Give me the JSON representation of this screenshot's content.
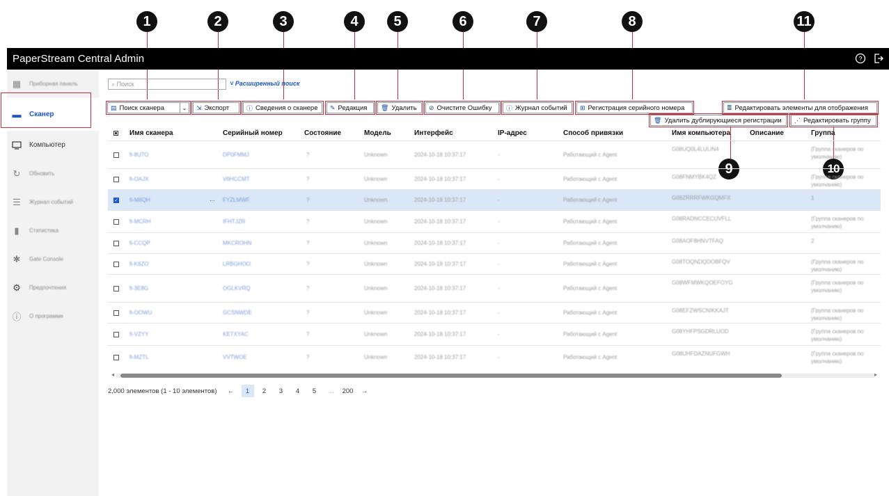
{
  "callouts": [
    "1",
    "2",
    "3",
    "4",
    "5",
    "6",
    "7",
    "8",
    "9",
    "10",
    "11"
  ],
  "app": {
    "title": "PaperStream Central Admin"
  },
  "header_icons": [
    "help-icon",
    "logout-icon"
  ],
  "sidebar": {
    "items": [
      {
        "label": "Приборная панель",
        "icon": "dashboard-icon"
      },
      {
        "label": "Сканер",
        "icon": "scanner-icon"
      },
      {
        "label": "Компьютер",
        "icon": "computer-icon"
      },
      {
        "label": "Обновить",
        "icon": "refresh-icon"
      },
      {
        "label": "Журнал событий",
        "icon": "event-log-icon"
      },
      {
        "label": "Статистика",
        "icon": "statistics-icon"
      },
      {
        "label": "Gate Console",
        "icon": "gate-console-icon"
      },
      {
        "label": "Предпочтения",
        "icon": "preferences-icon"
      },
      {
        "label": "О программе",
        "icon": "about-icon"
      }
    ]
  },
  "search": {
    "placeholder": "Поиск",
    "advanced": "Расширенный поиск"
  },
  "toolbar": {
    "scanner_search": "Поиск сканера",
    "export": "Экспорт",
    "scanner_info": "Сведения о сканере",
    "edit": "Редакция",
    "delete": "Удалить",
    "clear_error": "Очистите Ошибку",
    "event_log": "Журнал событий",
    "serial_registration": "Регистрация серийного номера",
    "edit_display_items": "Редактировать элементы для отображения",
    "delete_duplicates": "Удалить дублирующиеся регистрации",
    "edit_group": "Редактировать группу"
  },
  "table": {
    "headers": [
      "Имя сканера",
      "Серийный номер",
      "Состояние",
      "Модель",
      "Интерфейс",
      "IP-адрес",
      "Способ привязки",
      "Имя компьютера",
      "Описание",
      "Группа"
    ],
    "rows": [
      {
        "name": "fi-8U7O",
        "serial": "DP0FMMJ",
        "state": "?",
        "model": "Unknown",
        "iface": "2024-10-18 10:37:17",
        "ip": "-",
        "bind": "Работающий с Agent",
        "pc": "G08UQ0L4LULIN4",
        "desc": "",
        "group": "(Группа сканеров по умолчанию)"
      },
      {
        "name": "fi-OAJX",
        "serial": "V6HCCMT",
        "state": "?",
        "model": "Unknown",
        "iface": "2024-10-18 10:37:17",
        "ip": "-",
        "bind": "Работающий с Agent",
        "pc": "G08FNMYBK4QZ",
        "desc": "",
        "group": "(Группа сканеров по умолчанию)"
      },
      {
        "name": "fi-M8QH",
        "serial": "FYZLMWF",
        "state": "?",
        "model": "Unknown",
        "iface": "2024-10-18 10:37:17",
        "ip": "-",
        "bind": "Работающий с Agent",
        "pc": "G08ZRRRFWKGQMFX",
        "desc": "",
        "group": "1"
      },
      {
        "name": "fi-MCRH",
        "serial": "IFHTJZR",
        "state": "?",
        "model": "Unknown",
        "iface": "2024-10-18 10:37:17",
        "ip": "-",
        "bind": "Работающий с Agent",
        "pc": "G08RADNCCECUVFLL",
        "desc": "",
        "group": "(Группа сканеров по умолчанию)"
      },
      {
        "name": "fi-CCQP",
        "serial": "MKCROHN",
        "state": "?",
        "model": "Unknown",
        "iface": "2024-10-18 10:37:17",
        "ip": "-",
        "bind": "Работающий с Agent",
        "pc": "G08AOF8HNVTFAQ",
        "desc": "",
        "group": "2"
      },
      {
        "name": "fi-K6ZO",
        "serial": "LRBGHOO",
        "state": "?",
        "model": "Unknown",
        "iface": "2024-10-18 10:37:17",
        "ip": "-",
        "bind": "Работающий с Agent",
        "pc": "G08TOQNDQDOBFQV",
        "desc": "",
        "group": "(Группа сканеров по умолчанию)"
      },
      {
        "name": "fi-3E8G",
        "serial": "OGLKVRQ",
        "state": "?",
        "model": "Unknown",
        "iface": "2024-10-18 10:37:17",
        "ip": "-",
        "bind": "Работающий с Agent",
        "pc": "G08WFMWKQOEFOYG",
        "desc": "",
        "group": "(Группа сканеров по умолчанию)"
      },
      {
        "name": "fi-OOWU",
        "serial": "GCSNWDE",
        "state": "?",
        "model": "Unknown",
        "iface": "2024-10-18 10:37:17",
        "ip": "-",
        "bind": "Работающий с Agent",
        "pc": "G08EFZWSCNIKKAJT",
        "desc": "",
        "group": "(Группа сканеров по умолчанию)"
      },
      {
        "name": "fi-VZYY",
        "serial": "KETXYAC",
        "state": "?",
        "model": "Unknown",
        "iface": "2024-10-18 10:37:17",
        "ip": "-",
        "bind": "Работающий с Agent",
        "pc": "G08YHFPSGDRLUOD",
        "desc": "",
        "group": "(Группа сканеров по умолчанию)"
      },
      {
        "name": "fi-MZTL",
        "serial": "VVTWOE",
        "state": "?",
        "model": "Unknown",
        "iface": "2024-10-18 10:37:17",
        "ip": "-",
        "bind": "Работающий с Agent",
        "pc": "G08UHFDAZNUFGWH",
        "desc": "",
        "group": "(Группа сканеров по умолчанию)"
      }
    ]
  },
  "pagination": {
    "summary": "2,000 элементов (1 - 10 элементов)",
    "prev": "←",
    "pages": [
      "1",
      "2",
      "3",
      "4",
      "5",
      "...",
      "200"
    ],
    "next": "→"
  }
}
